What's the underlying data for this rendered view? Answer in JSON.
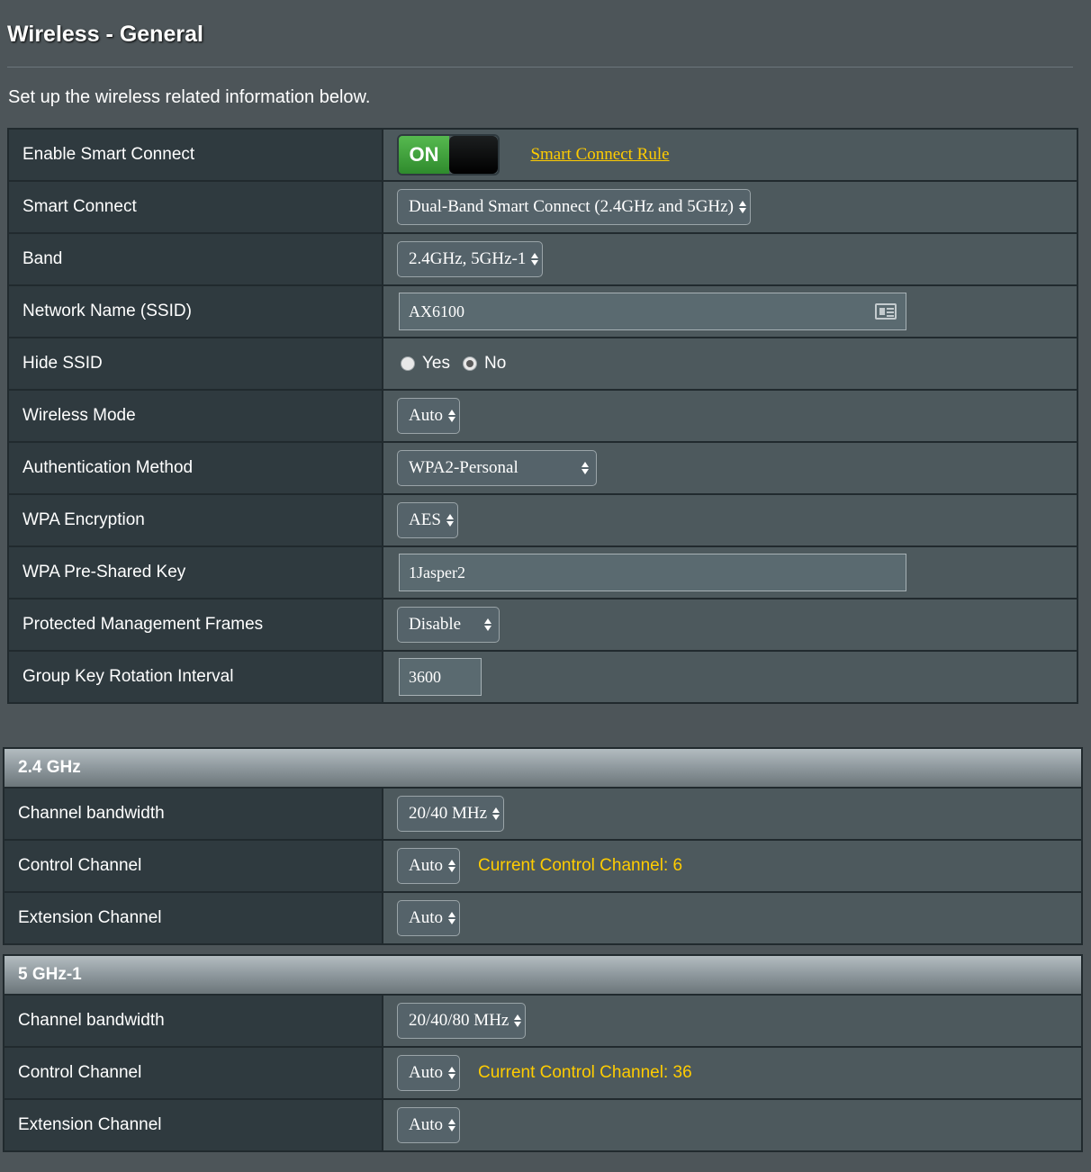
{
  "page": {
    "title": "Wireless - General",
    "description": "Set up the wireless related information below."
  },
  "general": {
    "smart_connect_enable": {
      "label": "Enable Smart Connect",
      "toggle": "ON",
      "rule_link": "Smart Connect Rule"
    },
    "smart_connect": {
      "label": "Smart Connect",
      "value": "Dual-Band Smart Connect (2.4GHz and 5GHz)"
    },
    "band": {
      "label": "Band",
      "value": "2.4GHz, 5GHz-1"
    },
    "ssid": {
      "label": "Network Name (SSID)",
      "value": "AX6100"
    },
    "hide_ssid": {
      "label": "Hide SSID",
      "options": [
        "Yes",
        "No"
      ],
      "selected": "No"
    },
    "wireless_mode": {
      "label": "Wireless Mode",
      "value": "Auto"
    },
    "auth_method": {
      "label": "Authentication Method",
      "value": "WPA2-Personal"
    },
    "wpa_encryption": {
      "label": "WPA Encryption",
      "value": "AES"
    },
    "wpa_psk": {
      "label": "WPA Pre-Shared Key",
      "value": "1Jasper2"
    },
    "pmf": {
      "label": "Protected Management Frames",
      "value": "Disable"
    },
    "group_key_interval": {
      "label": "Group Key Rotation Interval",
      "value": "3600"
    }
  },
  "band_24": {
    "header": "2.4 GHz",
    "channel_bandwidth": {
      "label": "Channel bandwidth",
      "value": "20/40 MHz"
    },
    "control_channel": {
      "label": "Control Channel",
      "value": "Auto",
      "current": "Current Control Channel: 6"
    },
    "extension_channel": {
      "label": "Extension Channel",
      "value": "Auto"
    }
  },
  "band_5": {
    "header": "5 GHz-1",
    "channel_bandwidth": {
      "label": "Channel bandwidth",
      "value": "20/40/80 MHz"
    },
    "control_channel": {
      "label": "Control Channel",
      "value": "Auto",
      "current": "Current Control Channel: 36"
    },
    "extension_channel": {
      "label": "Extension Channel",
      "value": "Auto"
    }
  },
  "colors": {
    "accent_yellow": "#ffcc00",
    "toggle_green": "#3a9a36",
    "label_bg": "#2f3a3f",
    "value_bg": "#4d595d"
  },
  "icons": {
    "ssid_field": "contact-card-icon",
    "select": "updown-arrows-icon"
  }
}
